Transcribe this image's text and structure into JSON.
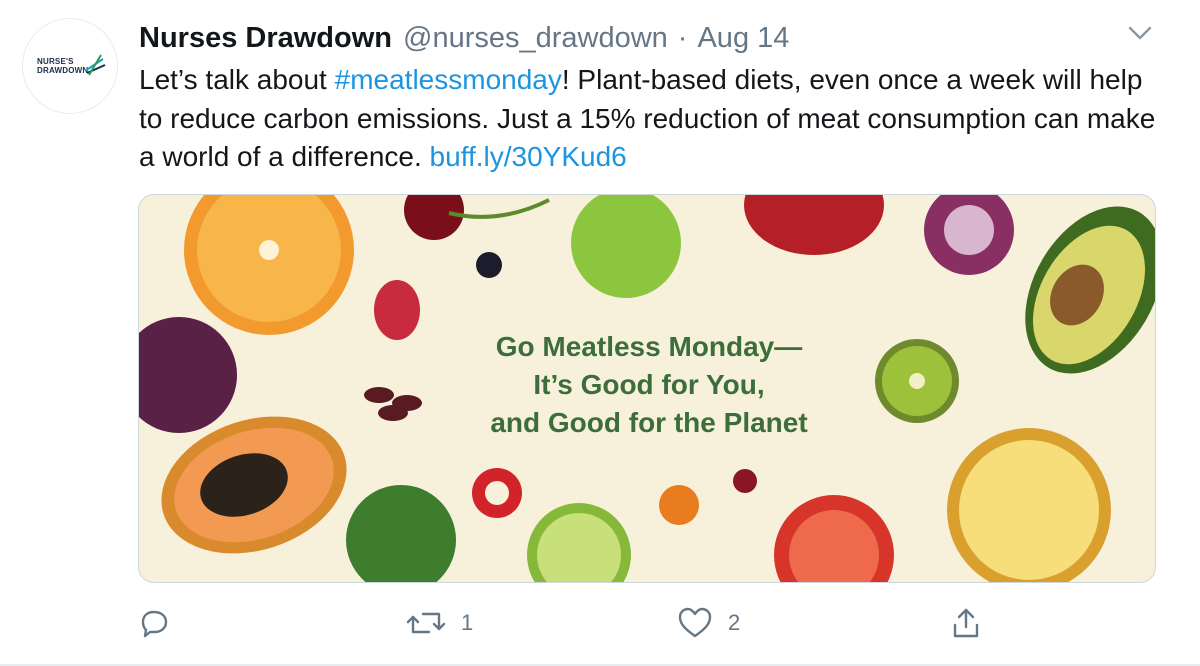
{
  "author": {
    "name": "Nurses Drawdown",
    "handle": "@nurses_drawdown",
    "separator": "·",
    "date": "Aug 14",
    "avatar_logo_line1": "NURSE'S",
    "avatar_logo_line2": "DRAWDOWN"
  },
  "tweet": {
    "text_before_tag": "Let’s talk about ",
    "hashtag": "#meatlessmonday",
    "text_after_tag": "! Plant-based diets, even once a week will help to reduce carbon emissions. Just a 15% reduction of meat consumption can make a world of a difference. ",
    "link": "buff.ly/30YKud6"
  },
  "card": {
    "headline_line1": "Go Meatless Monday—",
    "headline_line2": "It’s Good for You,",
    "headline_line3": "and Good for the Planet"
  },
  "actions": {
    "reply_count": "",
    "retweet_count": "1",
    "like_count": "2"
  },
  "colors": {
    "link": "#1b95e0",
    "muted": "#657786",
    "headline_green": "#3b6e3a",
    "card_bg": "#f7f1dc"
  },
  "icons": [
    "caret-down-icon",
    "reply-icon",
    "retweet-icon",
    "like-icon",
    "share-icon"
  ]
}
